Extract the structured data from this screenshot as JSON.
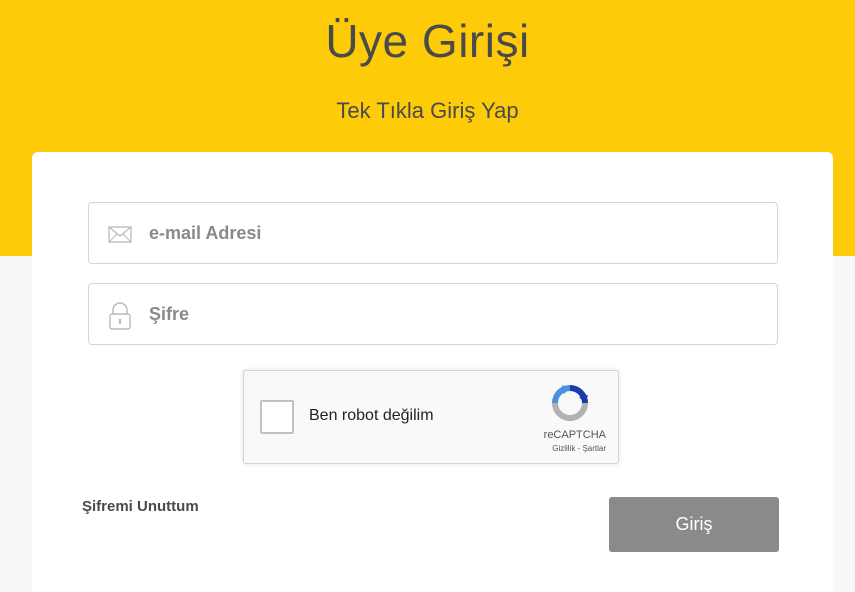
{
  "header": {
    "title": "Üye Girişi",
    "subtitle": "Tek Tıkla Giriş Yap"
  },
  "form": {
    "email": {
      "placeholder": "e-mail Adresi",
      "value": "",
      "icon": "envelope-icon"
    },
    "password": {
      "placeholder": "Şifre",
      "value": "",
      "icon": "lock-icon"
    },
    "recaptcha": {
      "label": "Ben robot değilim",
      "brand": "reCAPTCHA",
      "links": "Gizlilik - Şartlar",
      "icon": "recaptcha-logo-icon"
    },
    "forgot_label": "Şifremi Unuttum",
    "submit_label": "Giriş"
  },
  "colors": {
    "accent": "#fdcb08",
    "button": "#8a8a8a",
    "recaptcha_blue": "#1c3aa9",
    "recaptcha_lightblue": "#4a90e2",
    "recaptcha_gray": "#b2b2b2"
  }
}
